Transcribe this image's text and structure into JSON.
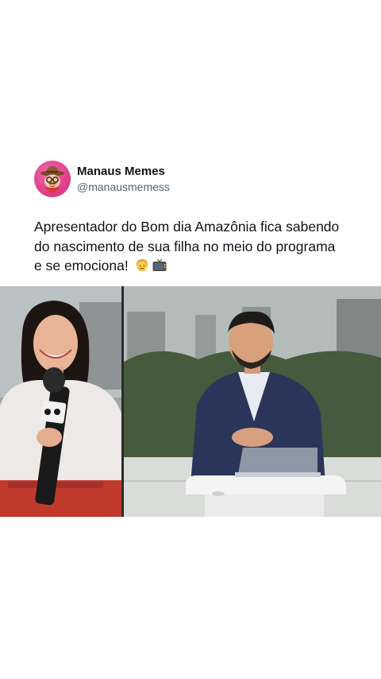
{
  "post": {
    "author": {
      "display_name": "Manaus Memes",
      "handle": "@manausmemess",
      "avatar_icon": "cowboy-character-avatar"
    },
    "text_lines": [
      "Apresentador do Bom dia Amazônia fica sabendo",
      "do nascimento de sua filha no meio do programa",
      "e se emociona!"
    ],
    "emojis": [
      "crying-face-emoji",
      "television-emoji"
    ],
    "media": {
      "type": "video-still",
      "description_icons": [
        "reporter-left-panel",
        "anchor-studio-right-panel"
      ]
    }
  },
  "colors": {
    "text": "#0f1419",
    "secondary": "#536471",
    "avatar_bg": "#e0408a",
    "background": "#ffffff"
  }
}
